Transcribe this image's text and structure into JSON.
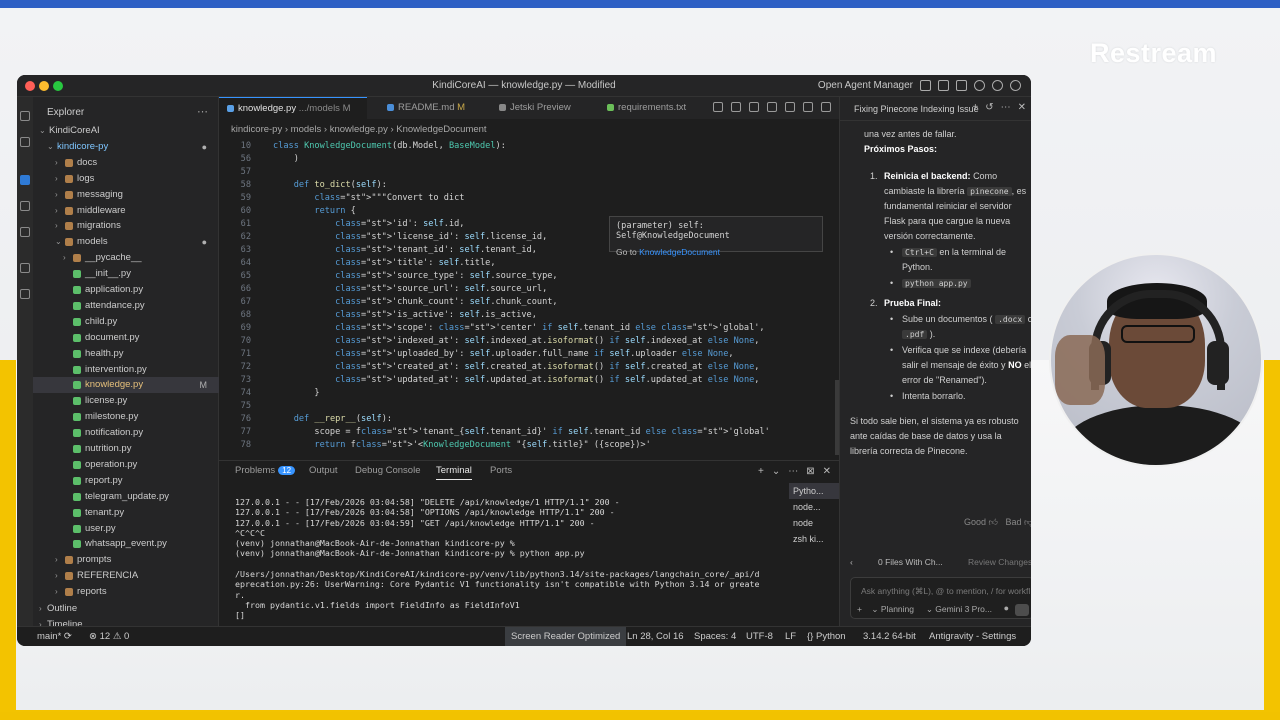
{
  "brand": "Restream",
  "window": {
    "title": "KindiCoreAI — knowledge.py — Modified",
    "agent_manager": "Open Agent Manager"
  },
  "explorer": {
    "header": "Explorer",
    "items": [
      {
        "label": "KindiCoreAI",
        "level": 0,
        "type": "folder",
        "open": true
      },
      {
        "label": "kindicore-py",
        "level": 1,
        "type": "folder",
        "open": true,
        "mark": "●"
      },
      {
        "label": "docs",
        "level": 2,
        "type": "folder",
        "open": false
      },
      {
        "label": "logs",
        "level": 2,
        "type": "folder",
        "open": false
      },
      {
        "label": "messaging",
        "level": 2,
        "type": "folder",
        "open": false
      },
      {
        "label": "middleware",
        "level": 2,
        "type": "folder",
        "open": false
      },
      {
        "label": "migrations",
        "level": 2,
        "type": "folder",
        "open": false
      },
      {
        "label": "models",
        "level": 2,
        "type": "folder",
        "open": true,
        "mark": "●"
      },
      {
        "label": "__pycache__",
        "level": 3,
        "type": "folder",
        "open": false
      },
      {
        "label": "__init__.py",
        "level": 3,
        "type": "file"
      },
      {
        "label": "application.py",
        "level": 3,
        "type": "file"
      },
      {
        "label": "attendance.py",
        "level": 3,
        "type": "file"
      },
      {
        "label": "child.py",
        "level": 3,
        "type": "file"
      },
      {
        "label": "document.py",
        "level": 3,
        "type": "file"
      },
      {
        "label": "health.py",
        "level": 3,
        "type": "file"
      },
      {
        "label": "intervention.py",
        "level": 3,
        "type": "file"
      },
      {
        "label": "knowledge.py",
        "level": 3,
        "type": "file",
        "selected": true,
        "mark": "M"
      },
      {
        "label": "license.py",
        "level": 3,
        "type": "file"
      },
      {
        "label": "milestone.py",
        "level": 3,
        "type": "file"
      },
      {
        "label": "notification.py",
        "level": 3,
        "type": "file"
      },
      {
        "label": "nutrition.py",
        "level": 3,
        "type": "file"
      },
      {
        "label": "operation.py",
        "level": 3,
        "type": "file"
      },
      {
        "label": "report.py",
        "level": 3,
        "type": "file"
      },
      {
        "label": "telegram_update.py",
        "level": 3,
        "type": "file"
      },
      {
        "label": "tenant.py",
        "level": 3,
        "type": "file"
      },
      {
        "label": "user.py",
        "level": 3,
        "type": "file"
      },
      {
        "label": "whatsapp_event.py",
        "level": 3,
        "type": "file"
      },
      {
        "label": "prompts",
        "level": 2,
        "type": "folder",
        "open": false
      },
      {
        "label": "REFERENCIA",
        "level": 2,
        "type": "folder",
        "open": false
      },
      {
        "label": "reports",
        "level": 2,
        "type": "folder",
        "open": false
      }
    ],
    "outline": "Outline",
    "timeline": "Timeline"
  },
  "tabs": [
    {
      "label": "knowledge.py",
      "suffix": ".../models M",
      "active": true
    },
    {
      "label": "README.md",
      "suffix": "M",
      "active": false
    },
    {
      "label": "Jetski Preview",
      "suffix": "",
      "active": false
    },
    {
      "label": "requirements.txt",
      "suffix": "",
      "active": false
    }
  ],
  "breadcrumb": "kindicore-py  ›  models  ›  knowledge.py  ›  KnowledgeDocument",
  "code": {
    "line_numbers": [
      "10",
      "56",
      "57",
      "58",
      "59",
      "60",
      "61",
      "62",
      "63",
      "64",
      "65",
      "66",
      "67",
      "68",
      "69",
      "70",
      "71",
      "72",
      "73",
      "74",
      "75",
      "76",
      "77",
      "78"
    ],
    "lines": [
      "class KnowledgeDocument(db.Model, BaseModel):",
      "    )",
      "",
      "    def to_dict(self):",
      "        \"\"\"Convert to dict",
      "        return {",
      "            'id': self.id,",
      "            'license_id': self.license_id,",
      "            'tenant_id': self.tenant_id,",
      "            'title': self.title,",
      "            'source_type': self.source_type,",
      "            'source_url': self.source_url,",
      "            'chunk_count': self.chunk_count,",
      "            'is_active': self.is_active,",
      "            'scope': 'center' if self.tenant_id else 'global',",
      "            'indexed_at': self.indexed_at.isoformat() if self.indexed_at else None,",
      "            'uploaded_by': self.uploader.full_name if self.uploader else None,",
      "            'created_at': self.created_at.isoformat() if self.created_at else None,",
      "            'updated_at': self.updated_at.isoformat() if self.updated_at else None,",
      "        }",
      "",
      "    def __repr__(self):",
      "        scope = f'tenant_{self.tenant_id}' if self.tenant_id else 'global'",
      "        return f'<KnowledgeDocument \"{self.title}\" ({scope})>'"
    ],
    "hover": {
      "signature": "(parameter) self: Self@KnowledgeDocument",
      "goto_prefix": "Go to",
      "goto_link": "KnowledgeDocument"
    }
  },
  "panel": {
    "tabs": [
      {
        "label": "Problems",
        "badge": "12"
      },
      {
        "label": "Output"
      },
      {
        "label": "Debug Console"
      },
      {
        "label": "Terminal",
        "active": true
      },
      {
        "label": "Ports"
      }
    ],
    "terminal_text": "127.0.0.1 - - [17/Feb/2026 03:04:58] \"DELETE /api/knowledge/1 HTTP/1.1\" 200 -\n127.0.0.1 - - [17/Feb/2026 03:04:58] \"OPTIONS /api/knowledge HTTP/1.1\" 200 -\n127.0.0.1 - - [17/Feb/2026 03:04:59] \"GET /api/knowledge HTTP/1.1\" 200 -\n^C^C^C\n(venv) jonnathan@MacBook-Air-de-Jonnathan kindicore-py %\n(venv) jonnathan@MacBook-Air-de-Jonnathan kindicore-py % python app.py\n\n/Users/jonnathan/Desktop/KindiCoreAI/kindicore-py/venv/lib/python3.14/site-packages/langchain_core/_api/d\neprecation.py:26: UserWarning: Core Pydantic V1 functionality isn't compatible with Python 3.14 or greate\nr.\n  from pydantic.v1.fields import FieldInfo as FieldInfoV1\n[]",
    "terminals": [
      "Pytho...",
      "node...",
      "node",
      "zsh ki..."
    ]
  },
  "status": {
    "branch": "main*",
    "problems": "12",
    "warnings": "0",
    "reader": "Screen Reader Optimized",
    "position": "Ln 28, Col 16",
    "spaces": "Spaces: 4",
    "encoding": "UTF-8",
    "eol": "LF",
    "language": "{} Python",
    "interpreter": "3.14.2 64-bit",
    "settings": "Antigravity - Settings"
  },
  "chat": {
    "title": "Fixing Pinecone Indexing Issue",
    "intro": "una vez antes de fallar.",
    "next_steps": "Próximos Pasos:",
    "step1_title": "Reinicia el backend:",
    "step1_text_a": "Como cambiaste la librería",
    "step1_chip": "pinecone",
    "step1_text_b": ", es fundamental reiniciar el servidor Flask para que cargue la nueva versión correctamente.",
    "step1_bullet1_chip": "Ctrl+C",
    "step1_bullet1_text": "en la terminal de Python.",
    "step1_bullet2_chip": "python app.py",
    "step2_title": "Prueba Final:",
    "step2_b1_a": "Sube un documentos (",
    "step2_b1_chip1": ".docx",
    "step2_b1_mid": "o",
    "step2_b1_chip2": ".pdf",
    "step2_b1_end": ").",
    "step2_b2_a": "Verifica que se indexe (debería salir el mensaje de éxito y",
    "step2_b2_no": "NO",
    "step2_b2_b": "el error de \"Renamed\").",
    "step2_b3": "Intenta borrarlo.",
    "closing": "Si todo sale bien, el sistema ya es robusto ante caídas de base de datos y usa la librería correcta de Pinecone.",
    "feedback_good": "Good",
    "feedback_bad": "Bad",
    "files_changed": "0 Files With Ch...",
    "review": "Review Changes",
    "input_placeholder": "Ask anything (⌘L), @ to mention, / for workfl",
    "mode": "Planning",
    "model": "Gemini 3 Pro..."
  },
  "colors": {
    "accent": "#3794ff",
    "brand_blue": "#2e5fc4",
    "brand_yellow": "#f3c300"
  }
}
